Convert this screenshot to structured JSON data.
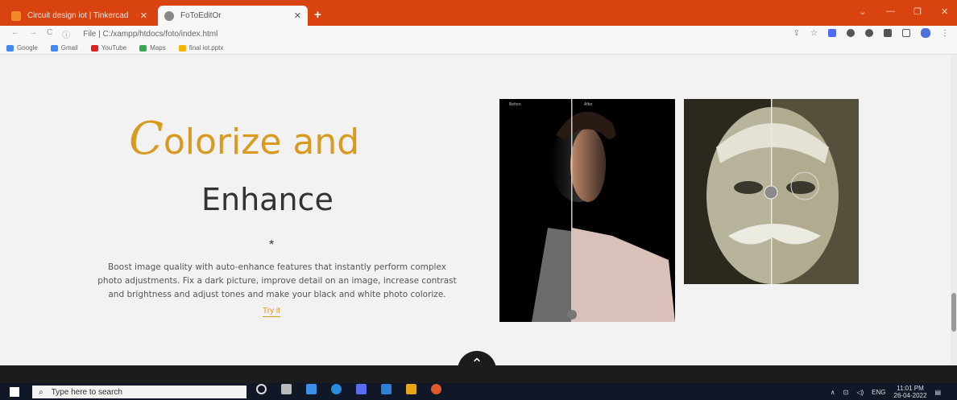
{
  "browser": {
    "tabs": [
      {
        "title": "Circuit design iot | Tinkercad",
        "color": "#f08a2a"
      },
      {
        "title": "FoToEditOr",
        "color": "#888888"
      }
    ],
    "address": "File | C:/xampp/htdocs/foto/index.html",
    "bookmarks": [
      {
        "label": "Google",
        "color": "#4285f4"
      },
      {
        "label": "Gmail",
        "color": "#4285f4"
      },
      {
        "label": "YouTube",
        "color": "#e02020"
      },
      {
        "label": "Maps",
        "color": "#34a853"
      },
      {
        "label": "final iot.pptx",
        "color": "#f4b400"
      }
    ],
    "extensions": [
      "#4a6cf7",
      "#555",
      "#555",
      "#555",
      "#555",
      "#4d6fd9"
    ]
  },
  "hero": {
    "title_first": "C",
    "title_rest": "olorize and",
    "subtitle": "Enhance",
    "divider": "*",
    "description": "Boost image quality with auto-enhance features that instantly perform complex photo adjustments. Fix a dark picture, improve detail on an image, increase contrast and brightness and adjust tones and make your black and white photo colorize.",
    "cta": "Try it",
    "before_label": "Before",
    "after_label": "After"
  },
  "taskbar": {
    "search_placeholder": "Type here to search",
    "lang": "ENG",
    "time": "11:01 PM",
    "date": "26-04-2022",
    "apps": [
      "#bbbbbb",
      "#3d8ee5",
      "#2a8cdc",
      "#5a6cf0",
      "#2e7fd6",
      "#e8a317",
      "#e05a2b"
    ]
  },
  "colors": {
    "accent": "#d89a1f",
    "tabbar": "#d9430f"
  }
}
